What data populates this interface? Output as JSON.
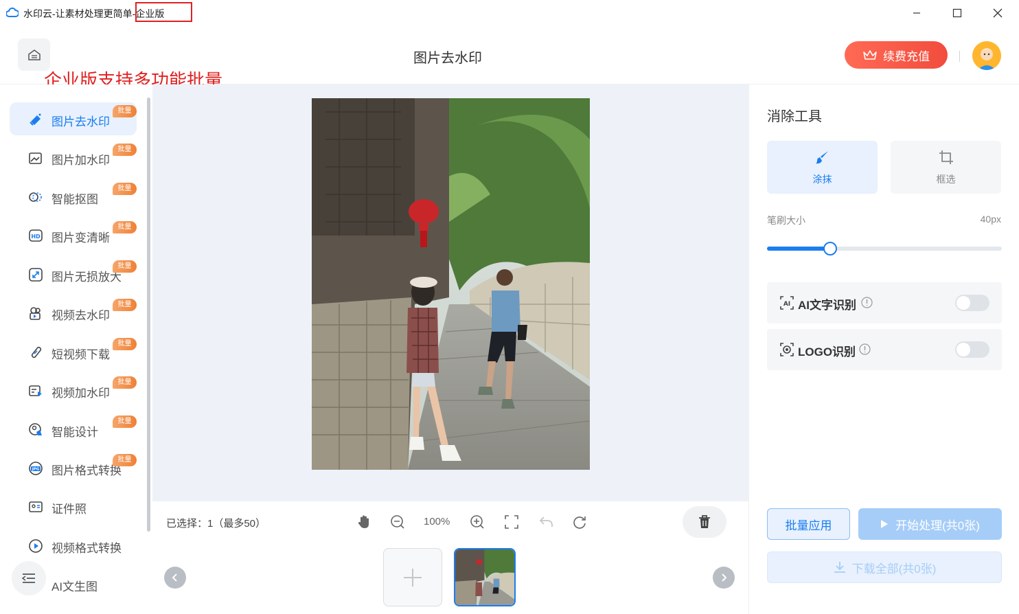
{
  "window": {
    "title": "水印云-让素材处理更简单-企业版",
    "controls": {
      "minimize": "minimize-icon",
      "maximize": "maximize-icon",
      "close": "close-icon"
    }
  },
  "header": {
    "page_title": "图片去水印",
    "annotation": "企业版支持多功能批量",
    "recharge_label": "续费充值",
    "accent": "#f24c3d"
  },
  "sidebar": {
    "badge_label": "批量",
    "items": [
      {
        "label": "图片去水印",
        "icon": "eraser-icon",
        "active": true,
        "badge": true
      },
      {
        "label": "图片加水印",
        "icon": "image-add-icon",
        "badge": true
      },
      {
        "label": "智能抠图",
        "icon": "cutout-icon",
        "badge": true
      },
      {
        "label": "图片变清晰",
        "icon": "hd-icon",
        "badge": true
      },
      {
        "label": "图片无损放大",
        "icon": "enlarge-icon",
        "badge": true
      },
      {
        "label": "视频去水印",
        "icon": "video-eraser-icon",
        "badge": true
      },
      {
        "label": "短视频下载",
        "icon": "download-link-icon",
        "badge": true
      },
      {
        "label": "视频加水印",
        "icon": "video-add-icon",
        "badge": true
      },
      {
        "label": "智能设计",
        "icon": "design-icon",
        "badge": true
      },
      {
        "label": "图片格式转换",
        "icon": "jpg-icon",
        "badge": true
      },
      {
        "label": "证件照",
        "icon": "id-photo-icon",
        "badge": false
      },
      {
        "label": "视频格式转换",
        "icon": "video-convert-icon",
        "badge": false
      },
      {
        "label": "AI文生图",
        "icon": "ai-image-icon",
        "badge": false
      }
    ]
  },
  "toolbar": {
    "selected": "已选择：1（最多50）",
    "zoom": "100%"
  },
  "right_panel": {
    "title": "消除工具",
    "tools": [
      {
        "label": "涂抹",
        "icon": "brush-icon",
        "active": true
      },
      {
        "label": "框选",
        "icon": "crop-icon",
        "active": false
      }
    ],
    "brush_size_label": "笔刷大小",
    "brush_size_value": "40px",
    "brush_level": 0.27,
    "options": [
      {
        "label": "AI文字识别",
        "icon": "ai-text-icon",
        "enabled": false
      },
      {
        "label": "LOGO识别",
        "icon": "logo-scan-icon",
        "enabled": false
      }
    ],
    "batch_apply": "批量应用",
    "start": "开始处理(共0张)",
    "download_all": "下载全部(共0张)",
    "accent": "#1a7df0"
  }
}
